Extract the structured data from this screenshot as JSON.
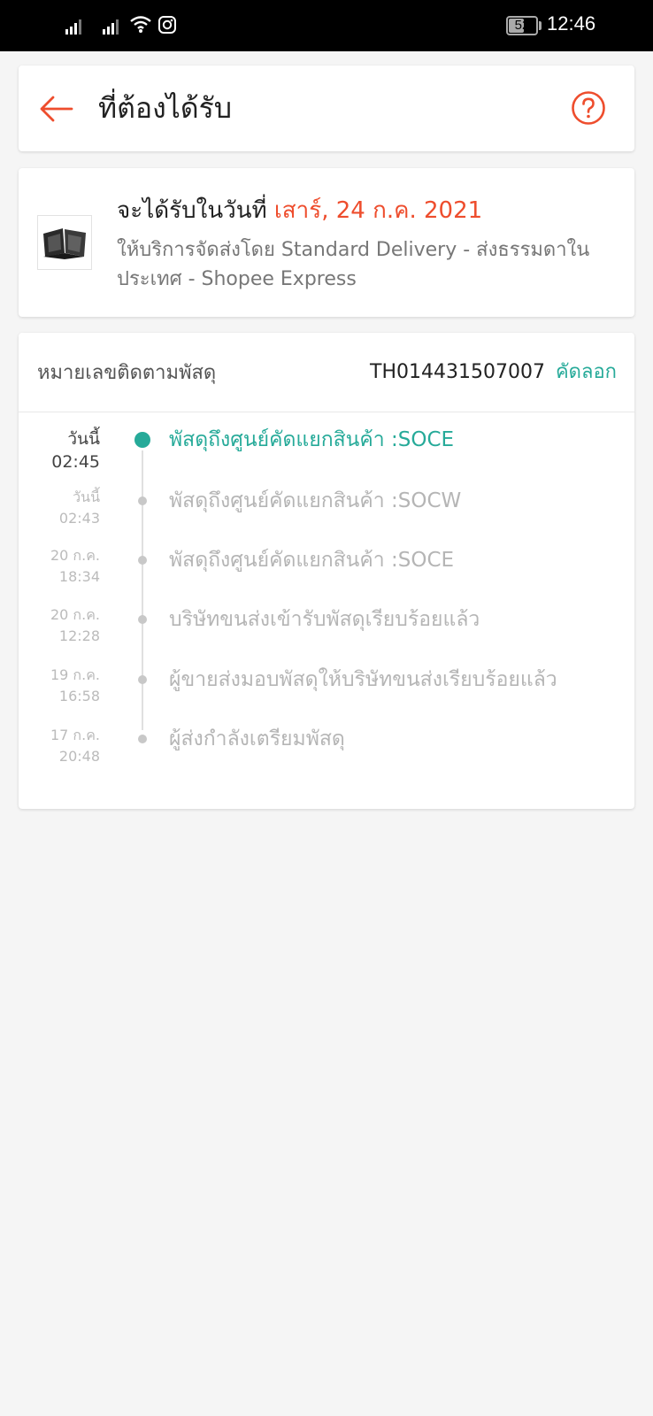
{
  "status_bar": {
    "time": "12:46",
    "battery": "52",
    "icons": [
      "signal-icon",
      "signal-icon",
      "wifi-icon",
      "instagram-icon",
      "battery-icon"
    ]
  },
  "header": {
    "title": "ที่ต้องได้รับ",
    "back_icon": "arrow-left-icon",
    "help_icon": "question-circle-icon"
  },
  "delivery": {
    "prefix": "จะได้รับในวันที่",
    "date": "เสาร์, 24 ก.ค. 2021",
    "description": "ให้บริการจัดส่งโดย Standard Delivery - ส่งธรรมดาในประเทศ - Shopee Express"
  },
  "tracking": {
    "label": "หมายเลขติดตามพัสดุ",
    "number": "TH014431507007",
    "copy_label": "คัดลอก",
    "events": [
      {
        "day": "วันนี้",
        "time": "02:45",
        "text": "พัสดุถึงศูนย์คัดแยกสินค้า :SOCE",
        "active": true
      },
      {
        "day": "วันนี้",
        "time": "02:43",
        "text": "พัสดุถึงศูนย์คัดแยกสินค้า :SOCW",
        "active": false
      },
      {
        "day": "20 ก.ค.",
        "time": "18:34",
        "text": "พัสดุถึงศูนย์คัดแยกสินค้า :SOCE",
        "active": false
      },
      {
        "day": "20 ก.ค.",
        "time": "12:28",
        "text": "บริษัทขนส่งเข้ารับพัสดุเรียบร้อยแล้ว",
        "active": false
      },
      {
        "day": "19 ก.ค.",
        "time": "16:58",
        "text": "ผู้ขายส่งมอบพัสดุให้บริษัทขนส่งเรียบร้อยแล้ว",
        "active": false
      },
      {
        "day": "17 ก.ค.",
        "time": "20:48",
        "text": "ผู้ส่งกำลังเตรียมพัสดุ",
        "active": false
      }
    ]
  },
  "colors": {
    "accent": "#ee4d2d",
    "teal": "#26aa99",
    "muted": "#b5b5b5",
    "background": "#f5f5f5"
  }
}
